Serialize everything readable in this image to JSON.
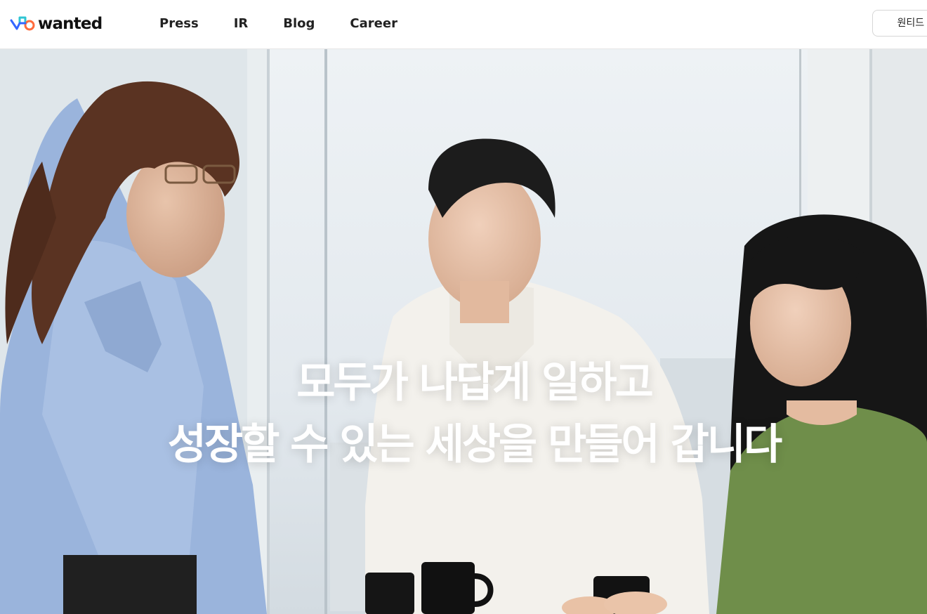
{
  "header": {
    "logo_text": "wanted",
    "nav": [
      "Press",
      "IR",
      "Blog",
      "Career"
    ],
    "home_button_label": "원티드 홈"
  },
  "hero": {
    "headline_line1": "모두가 나답게 일하고",
    "headline_line2": "성장할 수 있는 세상을 만들어 갑니다"
  },
  "colors": {
    "logo_blue": "#3366ff",
    "logo_orange": "#ff6b3d",
    "logo_teal": "#2ec5d3"
  },
  "icons": {
    "logo_mark": "wanted-logo-icon"
  }
}
